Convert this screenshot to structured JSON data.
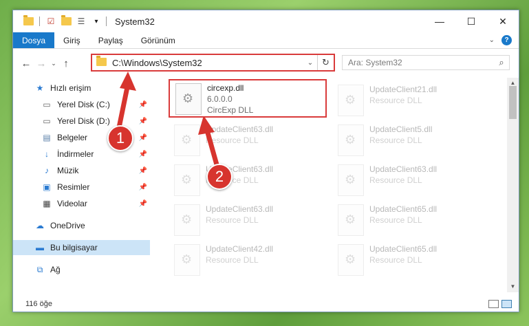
{
  "window": {
    "title": "System32"
  },
  "qat": {
    "dropdown_label": "▾"
  },
  "ribbon": {
    "tabs": [
      "Dosya",
      "Giriş",
      "Paylaş",
      "Görünüm"
    ]
  },
  "address": {
    "path": "C:\\Windows\\System32"
  },
  "search": {
    "placeholder": "Ara: System32"
  },
  "sidebar": {
    "items": [
      {
        "label": "Hızlı erişim",
        "icon": "star-icon"
      },
      {
        "label": "Yerel Disk (C:)",
        "icon": "drive-icon"
      },
      {
        "label": "Yerel Disk (D:)",
        "icon": "drive-icon"
      },
      {
        "label": "Belgeler",
        "icon": "document-icon"
      },
      {
        "label": "İndirmeler",
        "icon": "download-icon"
      },
      {
        "label": "Müzik",
        "icon": "music-icon"
      },
      {
        "label": "Resimler",
        "icon": "picture-icon"
      },
      {
        "label": "Videolar",
        "icon": "video-icon"
      },
      {
        "label": "OneDrive",
        "icon": "cloud-icon"
      },
      {
        "label": "Bu bilgisayar",
        "icon": "computer-icon"
      },
      {
        "label": "Ağ",
        "icon": "network-icon"
      }
    ]
  },
  "files": [
    {
      "name": "circexp.dll",
      "version": "6.0.0.0",
      "desc": "CircExp DLL"
    },
    {
      "name": "UpdateClient21.dll",
      "desc": "Resource DLL"
    },
    {
      "name": "UpdateClient63.dll",
      "desc": "Resource DLL"
    },
    {
      "name": "UpdateClient5.dll",
      "desc": "Resource DLL"
    },
    {
      "name": "UpdateClient63.dll",
      "desc": "Resource DLL"
    },
    {
      "name": "UpdateClient63.dll",
      "desc": "Resource DLL"
    },
    {
      "name": "UpdateClient63.dll",
      "desc": "Resource DLL"
    },
    {
      "name": "UpdateClient65.dll",
      "desc": "Resource DLL"
    },
    {
      "name": "UpdateClient42.dll",
      "desc": "Resource DLL"
    },
    {
      "name": "UpdateClient65.dll",
      "desc": "Resource DLL"
    }
  ],
  "status": {
    "count": "116 öğe"
  },
  "annotations": {
    "step1": "1",
    "step2": "2"
  },
  "colors": {
    "accent": "#1979ca",
    "highlight": "#d93a3a",
    "selected": "#cce4f7"
  }
}
